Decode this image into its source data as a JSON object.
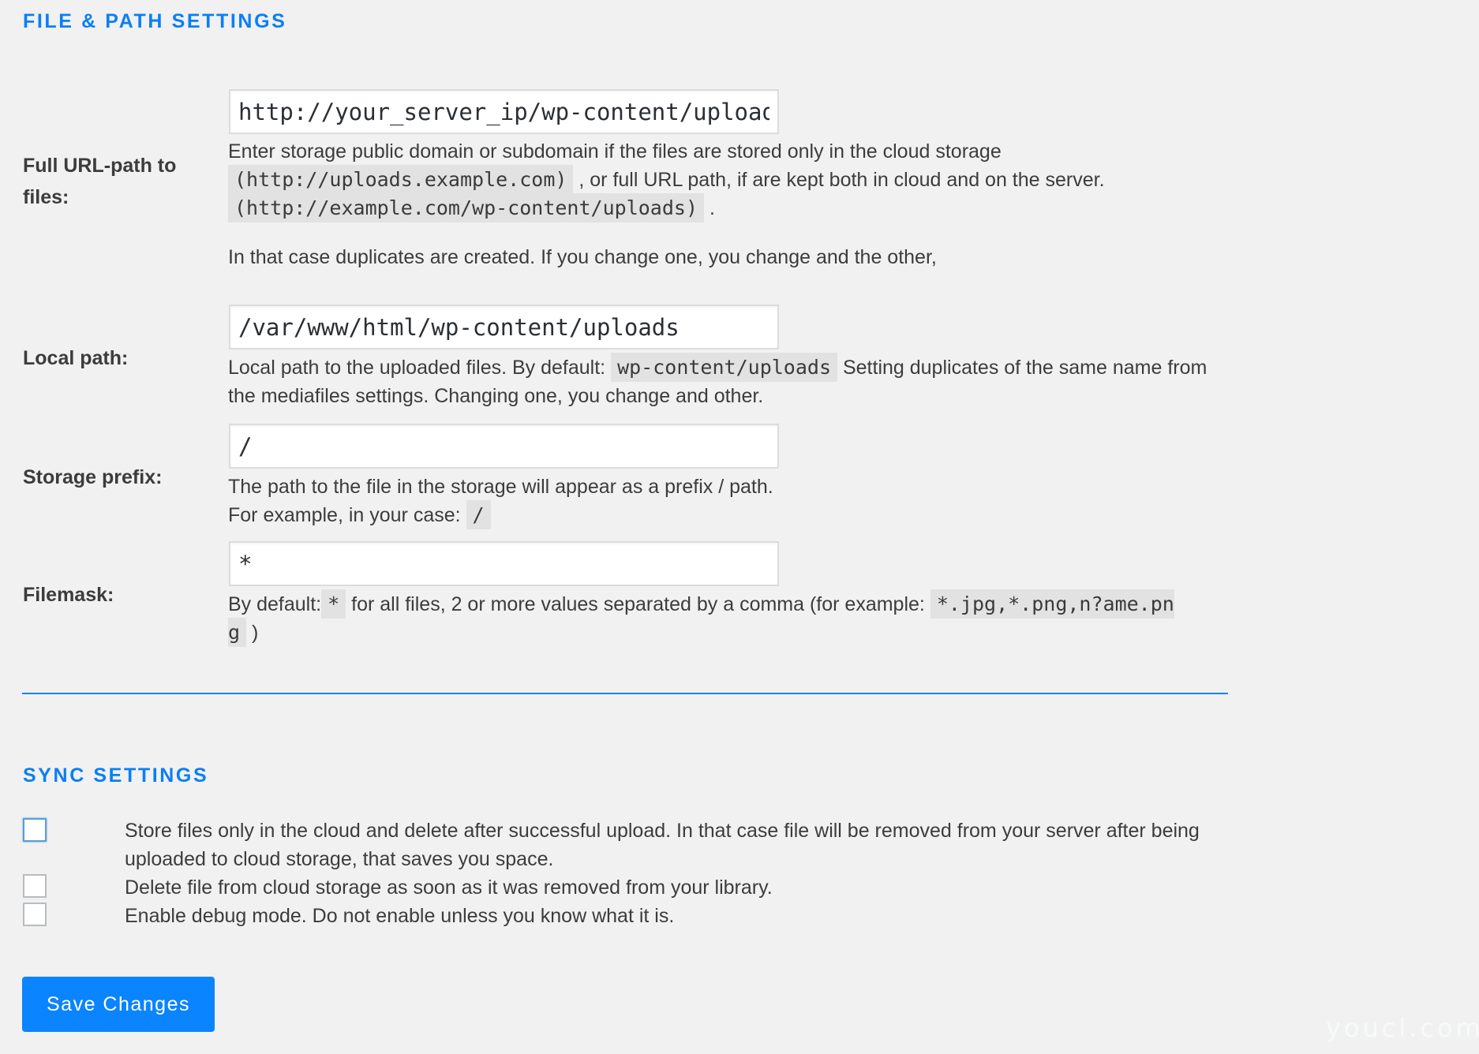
{
  "file_path_settings": {
    "title": "FILE & PATH SETTINGS",
    "full_url": {
      "label": "Full URL-path to files:",
      "value": "http://your_server_ip/wp-content/uploads",
      "desc_part1": "Enter storage public domain or subdomain if the files are stored only in the cloud storage",
      "code1": "(http://uploads.example.com)",
      "desc_part2": ", or full URL path, if are kept both in cloud and on the server.",
      "code2": "(http://example.com/wp-content/uploads)",
      "desc_part3": ".",
      "note": "In that case duplicates are created. If you change one, you change and the other,"
    },
    "local_path": {
      "label": "Local path:",
      "value": "/var/www/html/wp-content/uploads",
      "desc_part1": "Local path to the uploaded files. By default:",
      "code": "wp-content/uploads",
      "desc_part2": "Setting duplicates of the same name from the mediafiles settings. Changing one, you change and other."
    },
    "storage_prefix": {
      "label": "Storage prefix:",
      "value": "/",
      "desc_line1": "The path to the file in the storage will appear as a prefix / path.",
      "desc_line2": "For example, in your case:",
      "code": "/"
    },
    "filemask": {
      "label": "Filemask:",
      "value": "*",
      "desc_part1": "By default:",
      "code1": "*",
      "desc_part2": "for all files, 2 or more values separated by a comma (for example:",
      "code2": "*.jpg,*.png,n?ame.png",
      "desc_part3": ")"
    }
  },
  "sync_settings": {
    "title": "SYNC SETTINGS",
    "options": [
      {
        "label": "Store files only in the cloud and delete after successful upload. In that case file will be removed from your server after being uploaded to cloud storage, that saves you space.",
        "checked": false
      },
      {
        "label": "Delete file from cloud storage as soon as it was removed from your library.",
        "checked": false
      },
      {
        "label": "Enable debug mode. Do not enable unless you know what it is.",
        "checked": false
      }
    ]
  },
  "save_button": "Save Changes",
  "watermark": "youcl.com",
  "colors": {
    "accent": "#0a84ff",
    "background": "#f1f1f1",
    "text": "#3c3c3c"
  }
}
